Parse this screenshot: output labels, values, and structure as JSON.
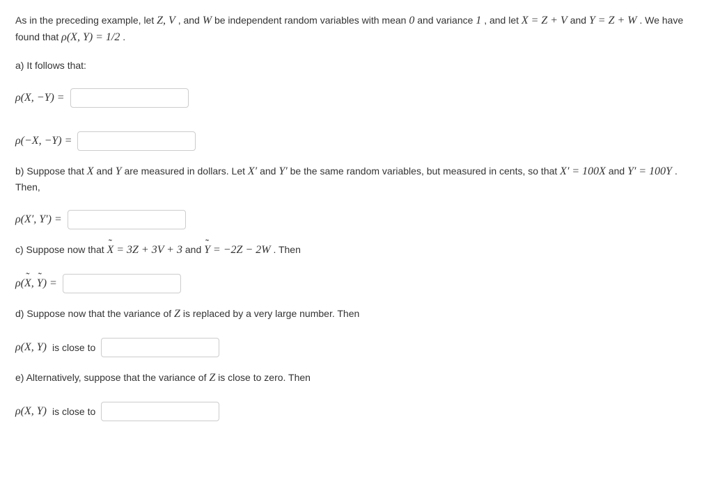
{
  "intro": {
    "pre": "As in the preceding example, let ",
    "vars": "Z, V",
    "and1": ", and ",
    "W": "W",
    "mid1": " be independent random variables with mean ",
    "zero": "0",
    "mid2": " and variance ",
    "one": "1",
    "mid3": ", and let ",
    "eqX_lhs": "X",
    "eq": " = ",
    "eqX_rhs": "Z + V",
    "and2": " and ",
    "eqY_lhs": "Y",
    "eqY_rhs": "Z + W",
    "foundPre": ". We have found that ",
    "rhoXY": "ρ(X, Y)",
    "half": "1/2",
    "period": "."
  },
  "a": {
    "prompt": "a) It follows that:",
    "rho1": "ρ(X, −Y) =",
    "rho2": "ρ(−X, −Y) ="
  },
  "b": {
    "pre": "b) Suppose that ",
    "X": "X",
    "and": " and ",
    "Y": "Y",
    "mid1": " are measured in dollars. Let ",
    "Xp": "X′",
    "Yp": "Y′",
    "mid2": " be the same random variables, but measured in cents, so that ",
    "eq1_lhs": "X′",
    "eq": " = ",
    "eq1_rhs": "100X",
    "andText": " and ",
    "eq2_lhs": "Y′",
    "eq2_rhs": "100Y",
    "then": ". Then,",
    "rho": "ρ(X′, Y′) ="
  },
  "c": {
    "pre": "c) Suppose now that ",
    "Xt": "X",
    "eq": " = ",
    "rhs1": "3Z + 3V + 3",
    "and": " and ",
    "Yt": "Y",
    "rhs2": "−2Z − 2W",
    "then": ". Then",
    "rho_pre": "ρ(",
    "rho_mid": ", ",
    "rho_post": ") ="
  },
  "d": {
    "pre": "d) Suppose now that the variance of ",
    "Z": "Z",
    "post": " is replaced by a very large number. Then",
    "rho": "ρ(X, Y)",
    "close": " is close to"
  },
  "e": {
    "pre": "e) Alternatively, suppose that the variance of ",
    "Z": "Z",
    "post": " is close to zero. Then",
    "rho": "ρ(X, Y)",
    "close": " is close to"
  }
}
